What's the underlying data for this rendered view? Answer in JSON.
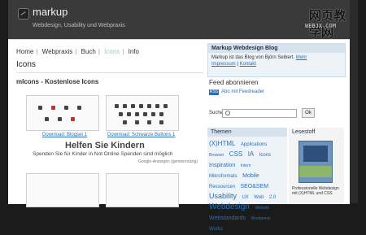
{
  "header": {
    "site_title": "markup",
    "tagline": "Webdesign, Usability und Webpraxis",
    "watermark": "网页教学网",
    "watermark_sub": "WEBJX.COM"
  },
  "breadcrumb": [
    "Home",
    "Webpraxis",
    "Buch",
    "Icons",
    "Info"
  ],
  "page_title": "Icons",
  "section_title": "mIcons - Kostenlose Icons",
  "downloads": [
    "Download: Blogset 1",
    "Download: Schwarze Buttons 1"
  ],
  "ad": {
    "title": "Helfen Sie Kindern",
    "text": "Spenden Sie für Kinder in Not Online Spenden sind möglich",
    "small": "Google-Anzeigen (gemeinnützig)"
  },
  "sidebar": {
    "blog_title": "Markup Webdesign Blog",
    "blog_text": "Markup ist das Blog von Björn Seibert.",
    "blog_more": "Mehr",
    "blog_links": [
      "Impressum",
      "Kontakt"
    ],
    "feed_title": "Feed abonnieren",
    "rss_label": "RSS",
    "feed_link": "Abo mit Feedreader",
    "search_label": "Suche:",
    "search_button": "Ok",
    "themen_title": "Themen",
    "tags": [
      {
        "label": "(X)HTML",
        "size": 8
      },
      {
        "label": "Applications",
        "size": 6
      },
      {
        "label": "Browser",
        "size": 5
      },
      {
        "label": "CSS",
        "size": 8
      },
      {
        "label": "IA",
        "size": 8
      },
      {
        "label": "Icons",
        "size": 6
      },
      {
        "label": "Inspiration",
        "size": 7
      },
      {
        "label": "Intern",
        "size": 5
      },
      {
        "label": "Mikroformats",
        "size": 6
      },
      {
        "label": "Mobile",
        "size": 7
      },
      {
        "label": "Ressourcen",
        "size": 6
      },
      {
        "label": "SEO&SEM",
        "size": 7
      },
      {
        "label": "Usability",
        "size": 9
      },
      {
        "label": "UX",
        "size": 6
      },
      {
        "label": "Web",
        "size": 6
      },
      {
        "label": "2.0",
        "size": 6
      },
      {
        "label": "Webdesign",
        "size": 10
      },
      {
        "label": "Website",
        "size": 5
      },
      {
        "label": "Webstandards",
        "size": 7
      },
      {
        "label": "Wordpress",
        "size": 5
      },
      {
        "label": "Works",
        "size": 6
      }
    ],
    "lesestoff_title": "Lesestoff",
    "book_text": "Professionelle Webdesign mit (X)HTML und CSS"
  }
}
